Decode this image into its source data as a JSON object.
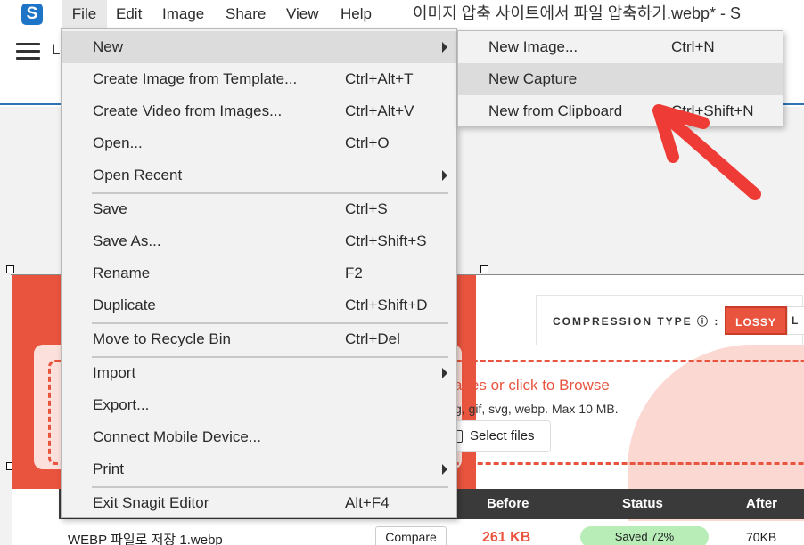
{
  "menubar": {
    "logo": "S",
    "items": [
      "File",
      "Edit",
      "Image",
      "Share",
      "View",
      "Help"
    ],
    "document_title": "이미지 압축 사이트에서 파일 압축하기.webp* - S"
  },
  "file_menu": {
    "items": [
      {
        "label": "New",
        "shortcut": "",
        "submenu": true
      },
      {
        "label": "Create Image from Template...",
        "shortcut": "Ctrl+Alt+T"
      },
      {
        "label": "Create Video from Images...",
        "shortcut": "Ctrl+Alt+V"
      },
      {
        "label": "Open...",
        "shortcut": "Ctrl+O"
      },
      {
        "label": "Open Recent",
        "shortcut": "",
        "submenu": true
      },
      {
        "label": "Save",
        "shortcut": "Ctrl+S"
      },
      {
        "label": "Save As...",
        "shortcut": "Ctrl+Shift+S"
      },
      {
        "label": "Rename",
        "shortcut": "F2"
      },
      {
        "label": "Duplicate",
        "shortcut": "Ctrl+Shift+D"
      },
      {
        "label": "Move to Recycle Bin",
        "shortcut": "Ctrl+Del"
      },
      {
        "label": "Import",
        "shortcut": "",
        "submenu": true
      },
      {
        "label": "Export...",
        "shortcut": ""
      },
      {
        "label": "Connect Mobile Device...",
        "shortcut": ""
      },
      {
        "label": "Print",
        "shortcut": "",
        "submenu": true
      },
      {
        "label": "Exit Snagit Editor",
        "shortcut": "Alt+F4"
      }
    ]
  },
  "new_submenu": {
    "items": [
      {
        "label": "New Image...",
        "shortcut": "Ctrl+N"
      },
      {
        "label": "New Capture",
        "shortcut": ""
      },
      {
        "label": "New from Clipboard",
        "shortcut": "Ctrl+Shift+N"
      }
    ]
  },
  "toolbar": {
    "partial_label": "L"
  },
  "webpage": {
    "compression_label": "COMPRESSION TYPE ⓘ :",
    "lossy_label": "LOSSY",
    "lossless_label": "L",
    "drop_title": "ages or click to Browse",
    "drop_subtitle": "g, gif, svg, webp. Max 10 MB.",
    "select_files_label": "Select files",
    "table_headers": {
      "before": "Before",
      "status": "Status",
      "after": "After"
    },
    "row": {
      "name": "WEBP 파일로 저장 1.webp",
      "compare_label": "Compare",
      "before": "261 KB",
      "status": "Saved 72%",
      "after": "70KB"
    }
  },
  "colors": {
    "accent_red": "#e9543f",
    "menu_bg": "#f2f2f2",
    "menu_highlight": "#dcdcdc",
    "arrow_red": "#ef3b36",
    "status_green": "#b8edb8"
  }
}
